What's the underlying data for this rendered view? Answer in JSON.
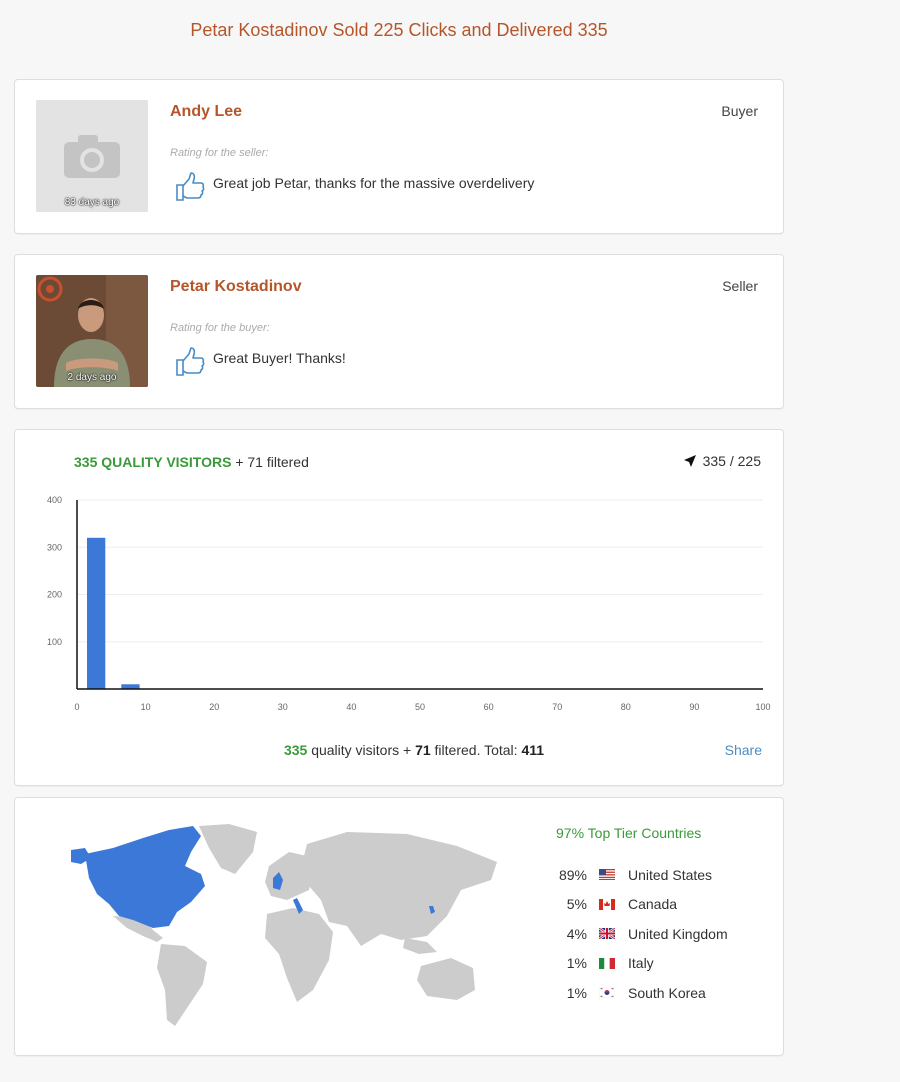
{
  "page_title": "Petar Kostadinov Sold 225 Clicks and Delivered 335",
  "reviews": [
    {
      "name": "Andy Lee",
      "role": "Buyer",
      "caption": "Rating for the seller:",
      "text": "Great job Petar, thanks for the massive overdelivery",
      "time": "83 days ago",
      "avatar": "camera-placeholder-icon"
    },
    {
      "name": "Petar Kostadinov",
      "role": "Seller",
      "caption": "Rating for the buyer:",
      "text": "Great Buyer! Thanks!",
      "time": "2 days ago",
      "avatar": "user-photo"
    }
  ],
  "visitors": {
    "quality_label": "335 QUALITY VISITORS",
    "filtered_label": "+ 71 filtered",
    "ratio": "335 / 225",
    "footer": {
      "quality_value": "335",
      "quality_text": "quality visitors +",
      "filtered_value": "71",
      "filtered_text": "filtered. Total:",
      "total_value": "411"
    },
    "share_label": "Share"
  },
  "chart_data": {
    "type": "bar",
    "x": [
      0,
      5
    ],
    "values": [
      320,
      10
    ],
    "bin_width": 5,
    "xlim": [
      0,
      100
    ],
    "ylim": [
      0,
      400
    ],
    "x_ticks": [
      0,
      10,
      20,
      30,
      40,
      50,
      60,
      70,
      80,
      90,
      100
    ],
    "y_ticks": [
      100,
      200,
      300,
      400
    ],
    "color": "#3c78d8"
  },
  "countries": {
    "header": "97% Top Tier Countries",
    "items": [
      {
        "pct": "89%",
        "name": "United States",
        "flag": "us-flag-icon"
      },
      {
        "pct": "5%",
        "name": "Canada",
        "flag": "canada-flag-icon"
      },
      {
        "pct": "4%",
        "name": "United Kingdom",
        "flag": "uk-flag-icon"
      },
      {
        "pct": "1%",
        "name": "Italy",
        "flag": "italy-flag-icon"
      },
      {
        "pct": "1%",
        "name": "South Korea",
        "flag": "south-korea-flag-icon"
      }
    ]
  },
  "colors": {
    "accent": "#b5562a",
    "green": "#3a9a3a",
    "bar": "#3c78d8",
    "map_highlight": "#3c78d8",
    "map_land": "#cccccc",
    "link": "#4a8cc4"
  }
}
